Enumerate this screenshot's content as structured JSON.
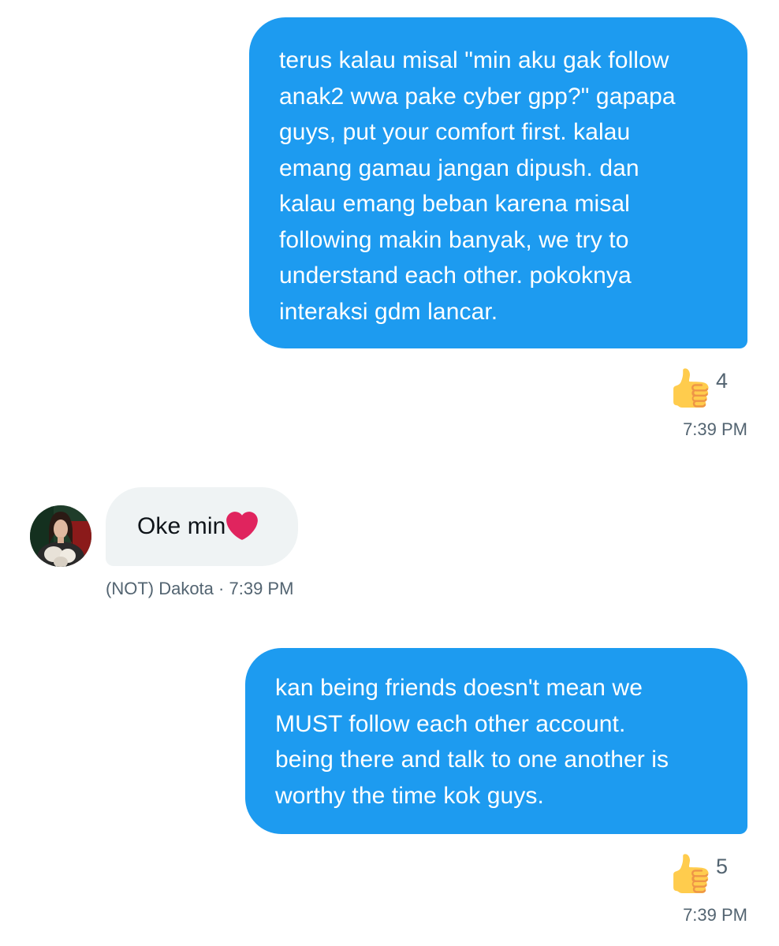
{
  "messages": [
    {
      "direction": "sent",
      "text": "terus kalau misal \"min aku gak follow\nanak2 wwa pake cyber gpp?\" gapapa\nguys, put your comfort first. kalau\nemang gamau jangan dipush. dan\nkalau emang beban karena misal\nfollowing makin banyak, we try to\nunderstand each other. pokoknya\ninteraksi gdm lancar.",
      "reaction": {
        "icon": "thumbs-up-icon",
        "count": "4"
      },
      "time": "7:39 PM"
    },
    {
      "direction": "received",
      "text": "Oke min",
      "emoji": "heart-icon",
      "sender": "(NOT) Dakota",
      "separator": "·",
      "time": "7:39 PM"
    },
    {
      "direction": "sent",
      "text": "kan being friends doesn't mean we\nMUST follow each other account.\nbeing there and talk to one another is\nworthy the time kok guys.",
      "reaction": {
        "icon": "thumbs-up-icon",
        "count": "5"
      },
      "time": "7:39 PM"
    }
  ],
  "colors": {
    "sent_bubble": "#1d9bf0",
    "received_bubble": "#eff3f4",
    "secondary_text": "#536471",
    "heart": "#e0245e",
    "thumb": "#ffcc4d"
  }
}
